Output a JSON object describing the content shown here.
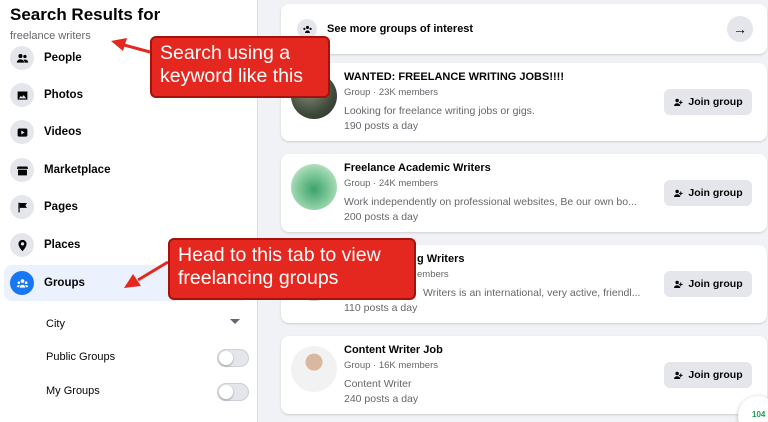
{
  "sidebar": {
    "title": "Search Results for",
    "query": "freelance writers",
    "items": [
      {
        "label": "People",
        "icon": "people-icon"
      },
      {
        "label": "Photos",
        "icon": "photos-icon"
      },
      {
        "label": "Videos",
        "icon": "video-icon"
      },
      {
        "label": "Marketplace",
        "icon": "marketplace-icon"
      },
      {
        "label": "Pages",
        "icon": "flag-icon"
      },
      {
        "label": "Places",
        "icon": "location-pin-icon"
      },
      {
        "label": "Groups",
        "icon": "groups-icon",
        "active": true
      }
    ],
    "filters": {
      "city": "City",
      "public_groups": "Public Groups",
      "my_groups": "My Groups"
    }
  },
  "main": {
    "see_more": "See more groups of interest",
    "groups": [
      {
        "name": "WANTED: FREELANCE WRITING JOBS!!!!",
        "meta": "Group · 23K members",
        "description": "Looking for freelance writing jobs or gigs.",
        "posts": "190 posts a day",
        "join_label": "Join group"
      },
      {
        "name": "Freelance Academic Writers",
        "meta": "Group · 24K members",
        "description": "Work independently on professional websites, Be our own bo...",
        "posts": "200 posts a day",
        "join_label": "Join group"
      },
      {
        "name": "g Writers",
        "meta": "embers",
        "description": "Writers is an international, very active, friendl...",
        "posts": "110 posts a day",
        "join_label": "Join group"
      },
      {
        "name": "Content Writer Job",
        "meta": "Group · 16K members",
        "description": "Content Writer",
        "posts": "240 posts a day",
        "join_label": "Join group"
      }
    ]
  },
  "annotations": {
    "callout_1": "Search using a keyword like this",
    "callout_2": "Head to this tab to view freelancing groups"
  },
  "chat_badge": "104",
  "colors": {
    "accent": "#1877f2",
    "callout": "#e4271f",
    "background": "#f0f2f5"
  }
}
